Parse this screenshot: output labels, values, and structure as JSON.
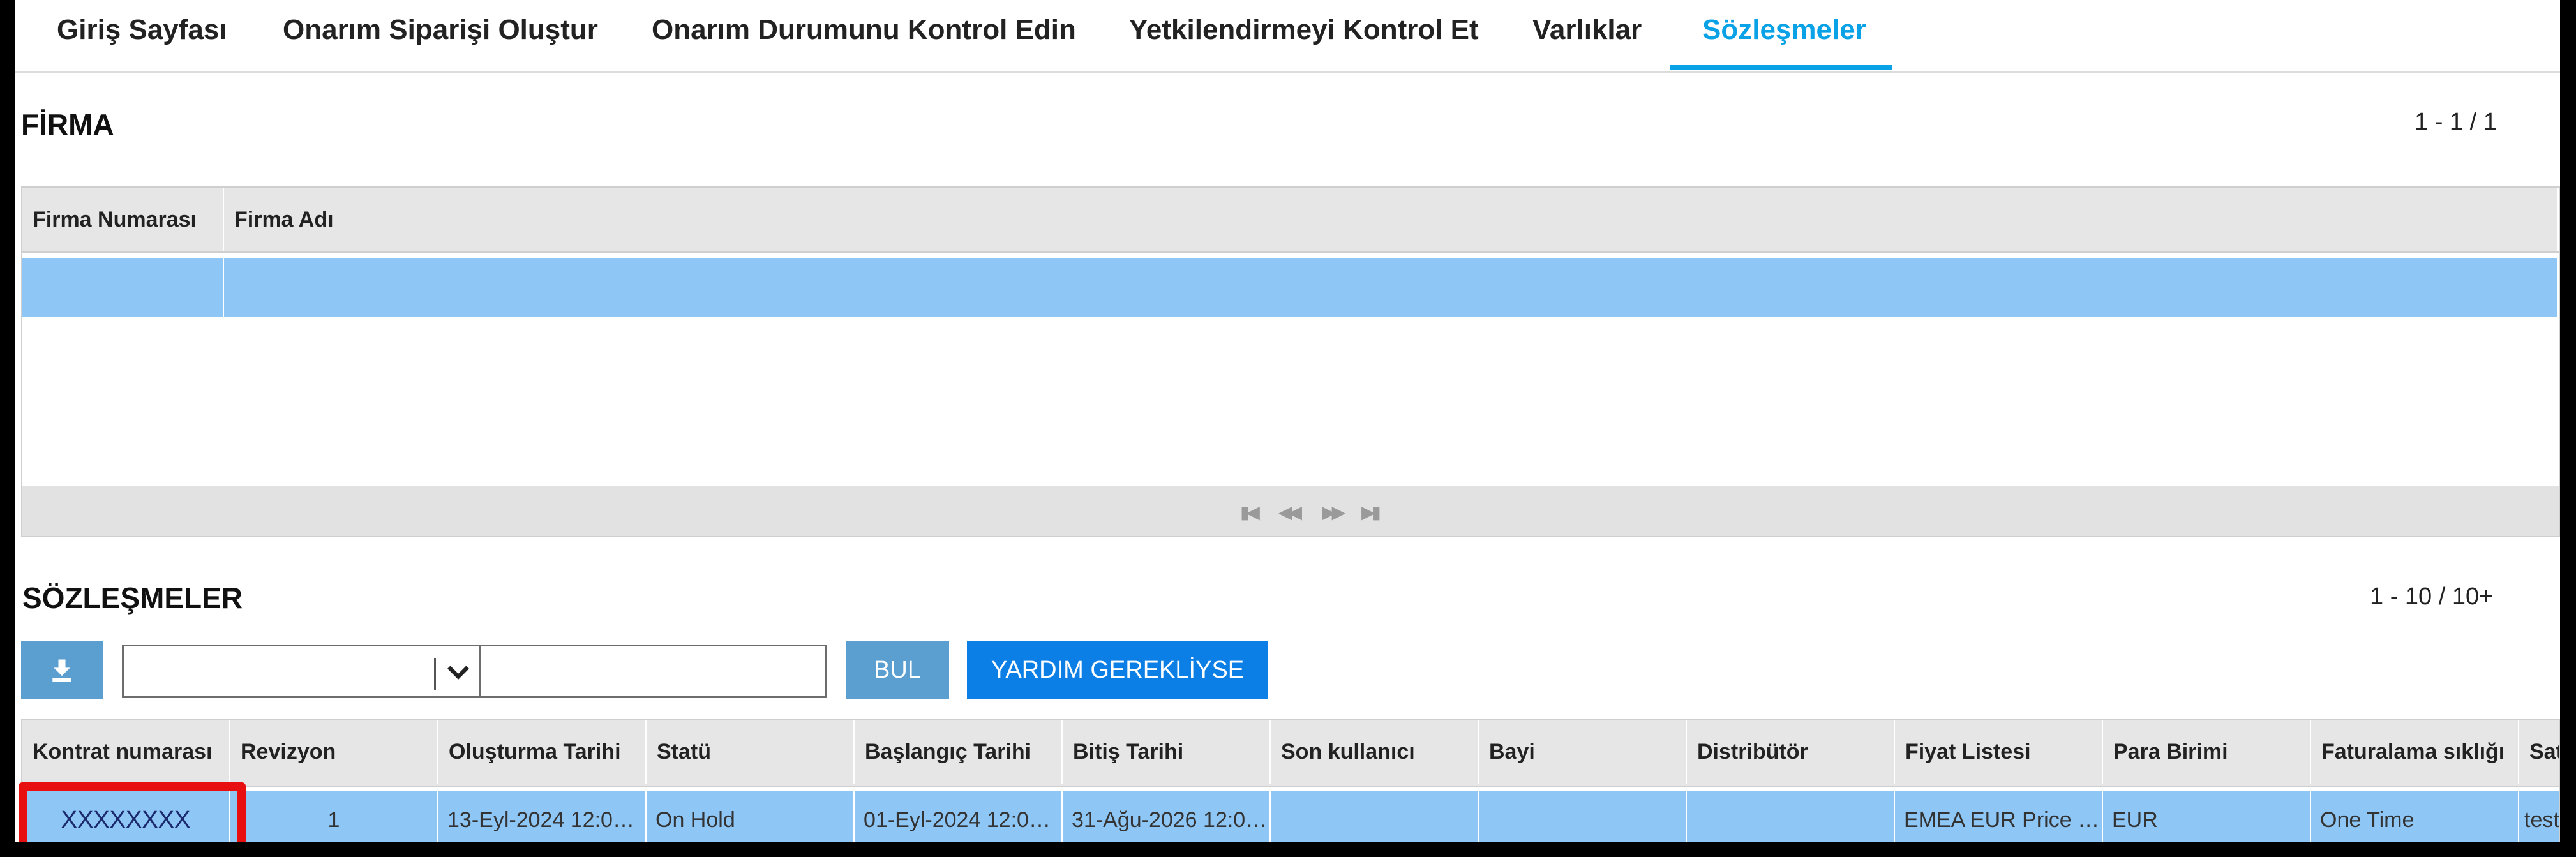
{
  "tabs": [
    {
      "label": "Giriş Sayfası"
    },
    {
      "label": "Onarım Siparişi Oluştur"
    },
    {
      "label": "Onarım Durumunu Kontrol Edin"
    },
    {
      "label": "Yetkilendirmeyi Kontrol Et"
    },
    {
      "label": "Varlıklar"
    },
    {
      "label": "Sözleşmeler"
    }
  ],
  "active_tab": "Sözleşmeler",
  "firma": {
    "title": "FİRMA",
    "pager": "1 - 1 / 1",
    "columns": [
      "Firma Numarası",
      "Firma Adı"
    ],
    "rows": [
      [
        "",
        ""
      ]
    ]
  },
  "sozlesmeler": {
    "title": "SÖZLEŞMELER",
    "pager": "1 - 10 / 10+",
    "toolbar": {
      "download_icon": "download-icon",
      "filter_select_value": "",
      "search_value": "",
      "find_button": "BUL",
      "help_button": "YARDIM GEREKLİYSE"
    },
    "columns": [
      "Kontrat numarası",
      "Revizyon",
      "Oluşturma Tarihi",
      "Statü",
      "Başlangıç Tarihi",
      "Bitiş Tarihi",
      "Son kullanıcı",
      "Bayi",
      "Distribütör",
      "Fiyat Listesi",
      "Para Birimi",
      "Faturalama sıklığı",
      "Satı"
    ],
    "rows": [
      [
        "XXXXXXXX",
        "1",
        "13-Eyl-2024 12:0…",
        "On Hold",
        "01-Eyl-2024 12:0…",
        "31-Ağu-2026 12:0…",
        "",
        "",
        "",
        "EMEA EUR Price …",
        "EUR",
        "One Time",
        "test"
      ]
    ]
  },
  "colors": {
    "accent": "#0aa2e6",
    "row_selected": "#8ec6f6",
    "button_primary": "#0c7fe6",
    "button_muted": "#5b9fd0",
    "highlight": "#e80f10"
  }
}
